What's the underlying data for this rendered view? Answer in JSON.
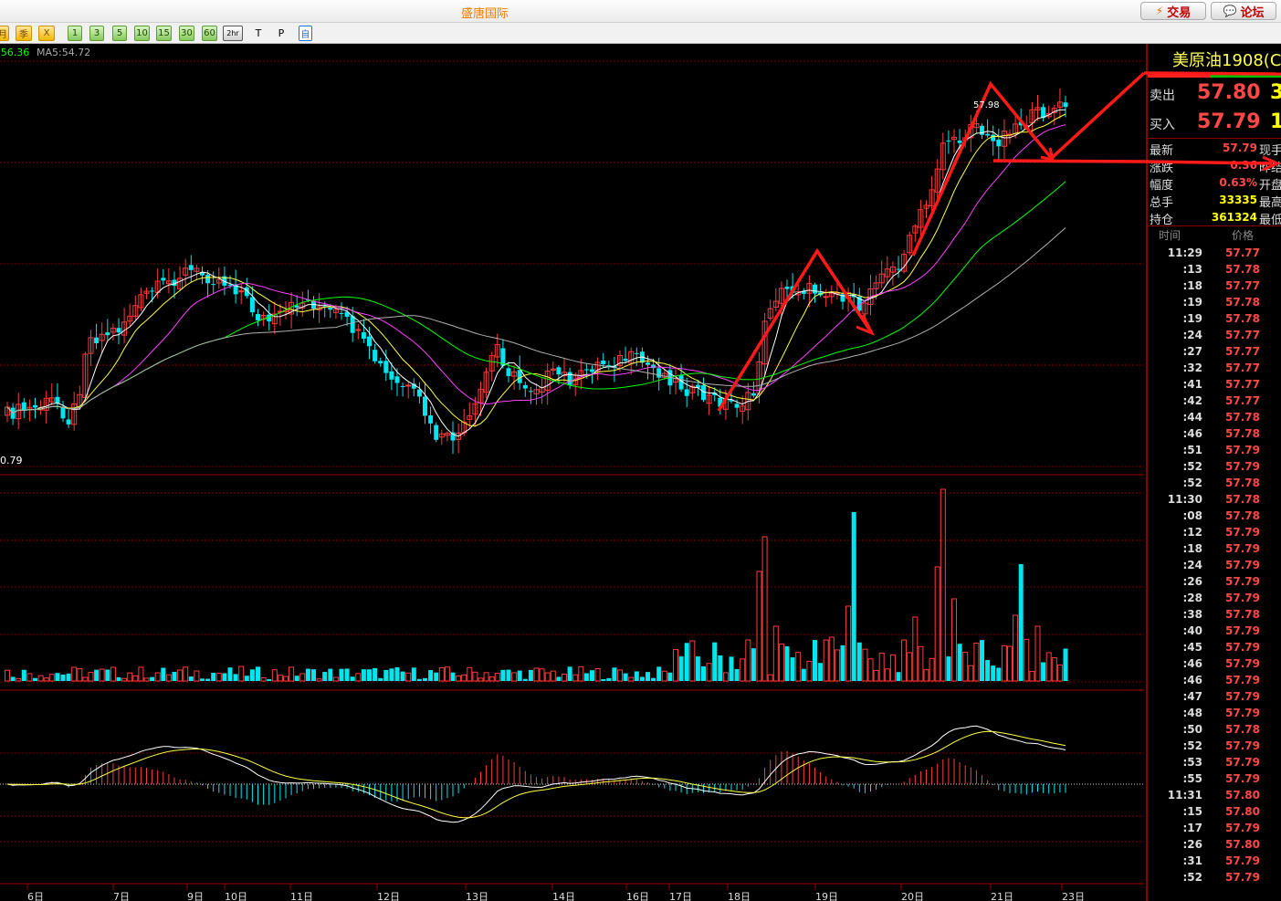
{
  "window": {
    "title": "盛唐国际",
    "trade_button": "交易",
    "forum_button": "论坛",
    "trade_icon": "lightning-icon",
    "forum_icon": "speech-bubble-icon"
  },
  "toolbar": {
    "buttons": [
      "月",
      "季",
      "X",
      "1",
      "3",
      "5",
      "10",
      "15",
      "30",
      "60",
      "2hr",
      "T",
      "P",
      "自"
    ],
    "selected": "2hr"
  },
  "chart": {
    "ma_readout_prev": ":56.36",
    "ma5_readout": "MA5:54.72",
    "high_label": "57.98",
    "low_label": "0.79",
    "date_labels": [
      "6日",
      "7日",
      "9日",
      "10日",
      "11日",
      "12日",
      "13日",
      "14日",
      "16日",
      "17日",
      "18日",
      "19日",
      "20日",
      "21日",
      "23日"
    ],
    "colors": {
      "up": "#ff3b3b",
      "down": "#00e5ee",
      "ma5": "#ffffff",
      "ma10": "#ffff40",
      "ma20": "#ff40ff",
      "ma40": "#00ff00",
      "ma60": "#b0b0b0",
      "annotation": "#ff1a1a"
    }
  },
  "chart_data": {
    "type": "candlestick",
    "title": "",
    "xlabel": "",
    "ylabel": "",
    "x": [
      "6日",
      "7日",
      "9日",
      "10日",
      "11日",
      "12日",
      "13日",
      "14日",
      "16日",
      "17日",
      "18日",
      "19日",
      "20日",
      "21日",
      "23日"
    ],
    "price_markers": {
      "high": 57.98,
      "low_axis_label": 0.79
    },
    "indicators": [
      "MA5",
      "volume",
      "MACD"
    ],
    "grid": true
  },
  "quote_panel": {
    "name": "美原油1908(C",
    "ask_label": "卖出",
    "ask_price": "57.80",
    "ask_volume": "3",
    "bid_label": "买入",
    "bid_price": "57.79",
    "bid_volume": "1",
    "stats": [
      {
        "label": "最新",
        "value": "57.79",
        "tail": "现手",
        "color": "red"
      },
      {
        "label": "涨跌",
        "value": "0.36",
        "tail": "昨结",
        "color": "red"
      },
      {
        "label": "幅度",
        "value": "0.63%",
        "tail": "开盘",
        "color": "red"
      },
      {
        "label": "总手",
        "value": "33335",
        "tail": "最高",
        "color": "yel"
      },
      {
        "label": "持仓",
        "value": "361324",
        "tail": "最低",
        "color": "yel"
      }
    ],
    "tick_header_time": "时间",
    "tick_header_price": "价格",
    "ticks": [
      {
        "time": "11:29",
        "price": "57.77"
      },
      {
        "time": ":13",
        "price": "57.78"
      },
      {
        "time": ":18",
        "price": "57.77"
      },
      {
        "time": ":19",
        "price": "57.78"
      },
      {
        "time": ":19",
        "price": "57.78"
      },
      {
        "time": ":24",
        "price": "57.77"
      },
      {
        "time": ":27",
        "price": "57.77"
      },
      {
        "time": ":32",
        "price": "57.77"
      },
      {
        "time": ":41",
        "price": "57.77"
      },
      {
        "time": ":42",
        "price": "57.77"
      },
      {
        "time": ":44",
        "price": "57.78"
      },
      {
        "time": ":46",
        "price": "57.78"
      },
      {
        "time": ":51",
        "price": "57.79"
      },
      {
        "time": ":52",
        "price": "57.79"
      },
      {
        "time": ":52",
        "price": "57.78"
      },
      {
        "time": "11:30",
        "price": "57.78"
      },
      {
        "time": ":08",
        "price": "57.78"
      },
      {
        "time": ":12",
        "price": "57.79"
      },
      {
        "time": ":18",
        "price": "57.79"
      },
      {
        "time": ":24",
        "price": "57.79"
      },
      {
        "time": ":26",
        "price": "57.79"
      },
      {
        "time": ":28",
        "price": "57.79"
      },
      {
        "time": ":38",
        "price": "57.78"
      },
      {
        "time": ":40",
        "price": "57.79"
      },
      {
        "time": ":45",
        "price": "57.79"
      },
      {
        "time": ":46",
        "price": "57.79"
      },
      {
        "time": ":46",
        "price": "57.79"
      },
      {
        "time": ":47",
        "price": "57.79"
      },
      {
        "time": ":48",
        "price": "57.79"
      },
      {
        "time": ":50",
        "price": "57.78"
      },
      {
        "time": ":52",
        "price": "57.79"
      },
      {
        "time": ":53",
        "price": "57.79"
      },
      {
        "time": ":55",
        "price": "57.79"
      },
      {
        "time": "11:31",
        "price": "57.80"
      },
      {
        "time": ":15",
        "price": "57.80"
      },
      {
        "time": ":17",
        "price": "57.79"
      },
      {
        "time": ":26",
        "price": "57.80"
      },
      {
        "time": ":31",
        "price": "57.79"
      },
      {
        "time": ":52",
        "price": "57.79"
      }
    ]
  }
}
